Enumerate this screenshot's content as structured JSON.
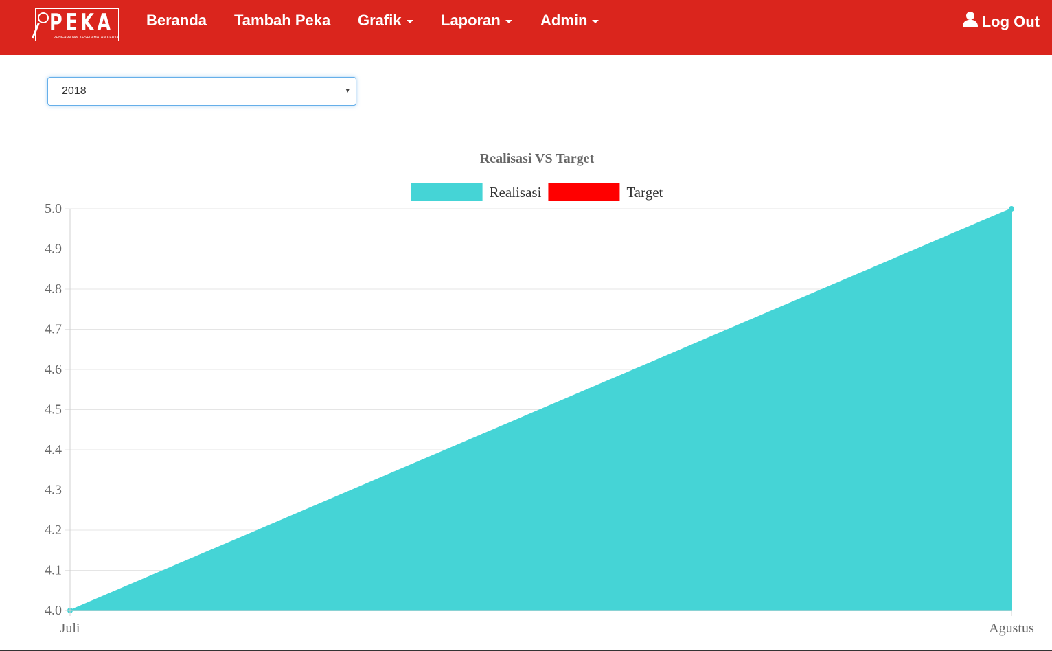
{
  "navbar": {
    "brand": "PEKA",
    "brand_sub": "PENGAMATAN KESELAMATAN KERJA",
    "items": [
      {
        "label": "Beranda"
      },
      {
        "label": "Tambah Peka"
      },
      {
        "label": "Grafik"
      },
      {
        "label": "Laporan"
      },
      {
        "label": "Admin"
      }
    ],
    "logout_label": "Log Out",
    "background_color": "#da251d"
  },
  "filter": {
    "selected_year": "2018"
  },
  "chart_data": {
    "type": "area",
    "title": "Realisasi VS Target",
    "categories": [
      "Juli",
      "Agustus"
    ],
    "series": [
      {
        "name": "Realisasi",
        "values": [
          4.0,
          5.0
        ],
        "color": "#45d4d6"
      },
      {
        "name": "Target",
        "values": [],
        "color": "#ff0000"
      }
    ],
    "ylim": [
      4.0,
      5.0
    ],
    "yticks": [
      "4.0",
      "4.1",
      "4.2",
      "4.3",
      "4.4",
      "4.5",
      "4.6",
      "4.7",
      "4.8",
      "4.9",
      "5.0"
    ],
    "grid": true,
    "legend_position": "top"
  }
}
